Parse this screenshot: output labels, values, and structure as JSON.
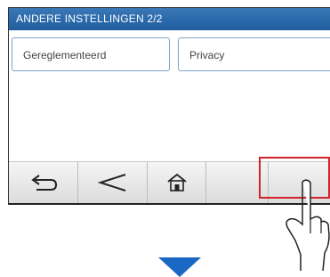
{
  "screen": {
    "title": "ANDERE INSTELLINGEN 2/2",
    "options": [
      {
        "label": "Gereglementeerd"
      },
      {
        "label": "Privacy"
      }
    ]
  },
  "toolbar": {
    "buttons": [
      {
        "icon": "back-arrow-icon"
      },
      {
        "icon": "chevron-left-icon"
      },
      {
        "icon": "home-icon"
      },
      {
        "icon": ""
      },
      {
        "icon": ""
      }
    ]
  },
  "colors": {
    "titlebar": "#1f5d9e",
    "highlight": "#d0232a",
    "arrow": "#1a68c4",
    "button_border": "#7fa3c8"
  }
}
